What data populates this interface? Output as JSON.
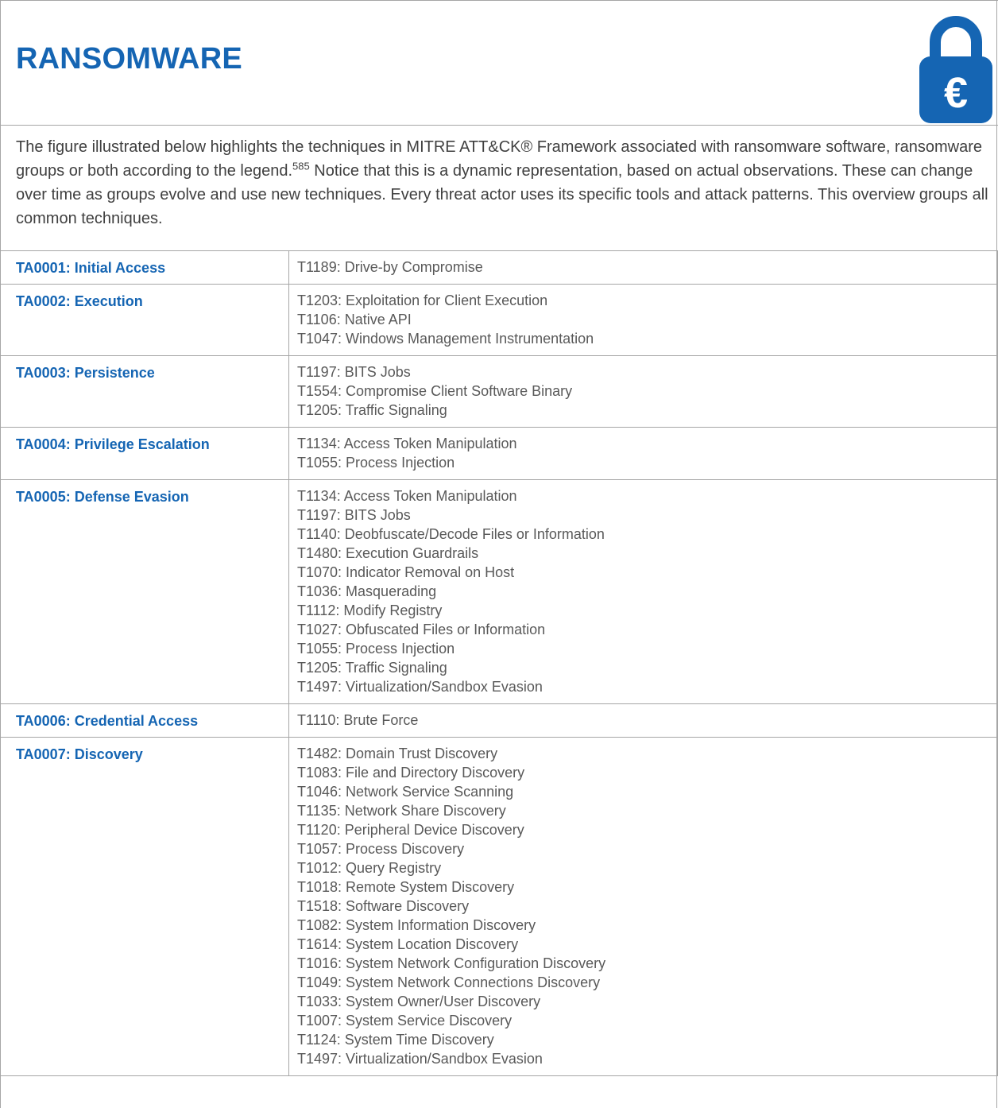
{
  "header": {
    "title": "RANSOMWARE",
    "icon": "padlock-euro-icon",
    "icon_symbol": "€",
    "accent_color": "#1565b3"
  },
  "intro": {
    "text_before_sup": "The figure illustrated below highlights the techniques in MITRE ATT&CK® Framework associated with ransomware software, ransomware groups or both according to the legend.",
    "footnote": "585",
    "text_after_sup": " Notice that this is a dynamic representation, based on actual observations. These can change over time as groups evolve and use new techniques. Every threat actor uses its specific tools and attack patterns. This overview groups all common techniques."
  },
  "tactics": [
    {
      "name": "TA0001: Initial Access",
      "techniques": [
        "T1189: Drive-by Compromise"
      ]
    },
    {
      "name": "TA0002: Execution",
      "techniques": [
        "T1203: Exploitation for Client Execution",
        "T1106: Native API",
        "T1047: Windows Management Instrumentation"
      ]
    },
    {
      "name": "TA0003: Persistence",
      "techniques": [
        "T1197: BITS Jobs",
        "T1554: Compromise Client Software Binary",
        "T1205: Traffic Signaling"
      ]
    },
    {
      "name": "TA0004: Privilege Escalation",
      "techniques": [
        "T1134: Access Token Manipulation",
        "T1055: Process Injection"
      ]
    },
    {
      "name": "TA0005: Defense Evasion",
      "techniques": [
        "T1134: Access Token Manipulation",
        "T1197: BITS Jobs",
        "T1140: Deobfuscate/Decode Files or Information",
        "T1480: Execution Guardrails",
        "T1070: Indicator Removal on Host",
        "T1036: Masquerading",
        "T1112: Modify Registry",
        "T1027: Obfuscated Files or Information",
        "T1055: Process Injection",
        "T1205: Traffic Signaling",
        "T1497: Virtualization/Sandbox Evasion"
      ]
    },
    {
      "name": "TA0006: Credential Access",
      "techniques": [
        "T1110: Brute Force"
      ]
    },
    {
      "name": "TA0007: Discovery",
      "techniques": [
        "T1482: Domain Trust Discovery",
        "T1083: File and Directory Discovery",
        "T1046: Network Service Scanning",
        "T1135: Network Share Discovery",
        "T1120: Peripheral Device Discovery",
        "T1057: Process Discovery",
        "T1012: Query Registry",
        "T1018: Remote System Discovery",
        "T1518: Software Discovery",
        "T1082: System Information Discovery",
        "T1614: System Location Discovery",
        "T1016: System Network Configuration Discovery",
        "T1049: System Network Connections Discovery",
        "T1033: System Owner/User Discovery",
        "T1007: System Service Discovery",
        "T1124: System Time Discovery",
        "T1497: Virtualization/Sandbox Evasion"
      ]
    }
  ]
}
